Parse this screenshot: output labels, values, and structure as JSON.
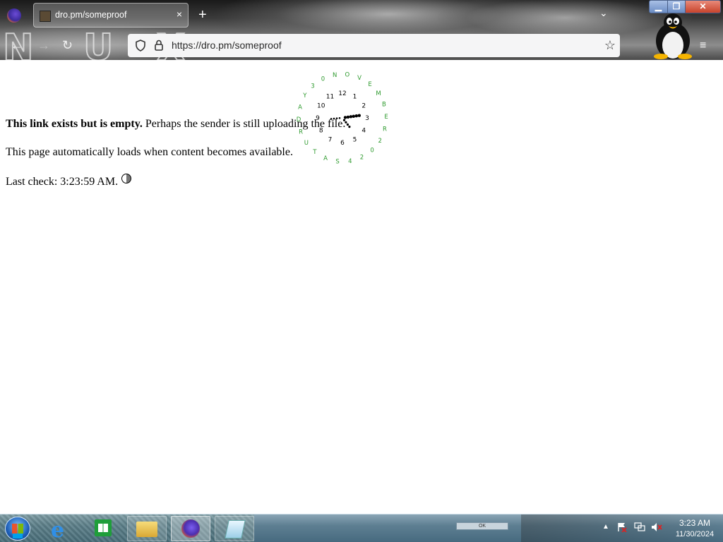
{
  "browser": {
    "tab_title": "dro.pm/someproof",
    "tab_close": "×",
    "new_tab": "+",
    "url": "https://dro.pm/someproof",
    "window_buttons": {
      "minimize": "▁",
      "maximize": "❐",
      "close": "✕"
    },
    "nav": {
      "back": "←",
      "forward": "→",
      "reload": "↻"
    },
    "tab_list": "⌄",
    "app_menu": "≡",
    "bookmark": "☆",
    "overlay_letters": [
      "N",
      "U",
      "X"
    ]
  },
  "page": {
    "bold_text": "This link exists but is empty.",
    "text_1_rest": " Perhaps the sender is still uploading the file.",
    "text_2": "This page automatically loads when content becomes available.",
    "last_check_label": "Last check: ",
    "last_check_time": "3:23:59 AM."
  },
  "clock_widget": {
    "hours": [
      "12",
      "1",
      "2",
      "3",
      "4",
      "5",
      "6",
      "7",
      "8",
      "9",
      "10",
      "11"
    ],
    "outer_text": [
      "N",
      "O",
      "V",
      "E",
      "M",
      "B",
      "E",
      "R",
      "2",
      "0",
      "2",
      "4",
      "S",
      "A",
      "T",
      "U",
      "R",
      "D",
      "A",
      "Y",
      "3",
      "0"
    ],
    "hour_color": "#000000",
    "outer_color": "#2e9a2e"
  },
  "taskbar": {
    "apps": [
      "start",
      "internet-explorer",
      "store",
      "file-explorer",
      "firefox",
      "notes"
    ],
    "tray_expand": "▲",
    "time": "3:23 AM",
    "date": "11/30/2024",
    "mid_box_label": "OK"
  }
}
